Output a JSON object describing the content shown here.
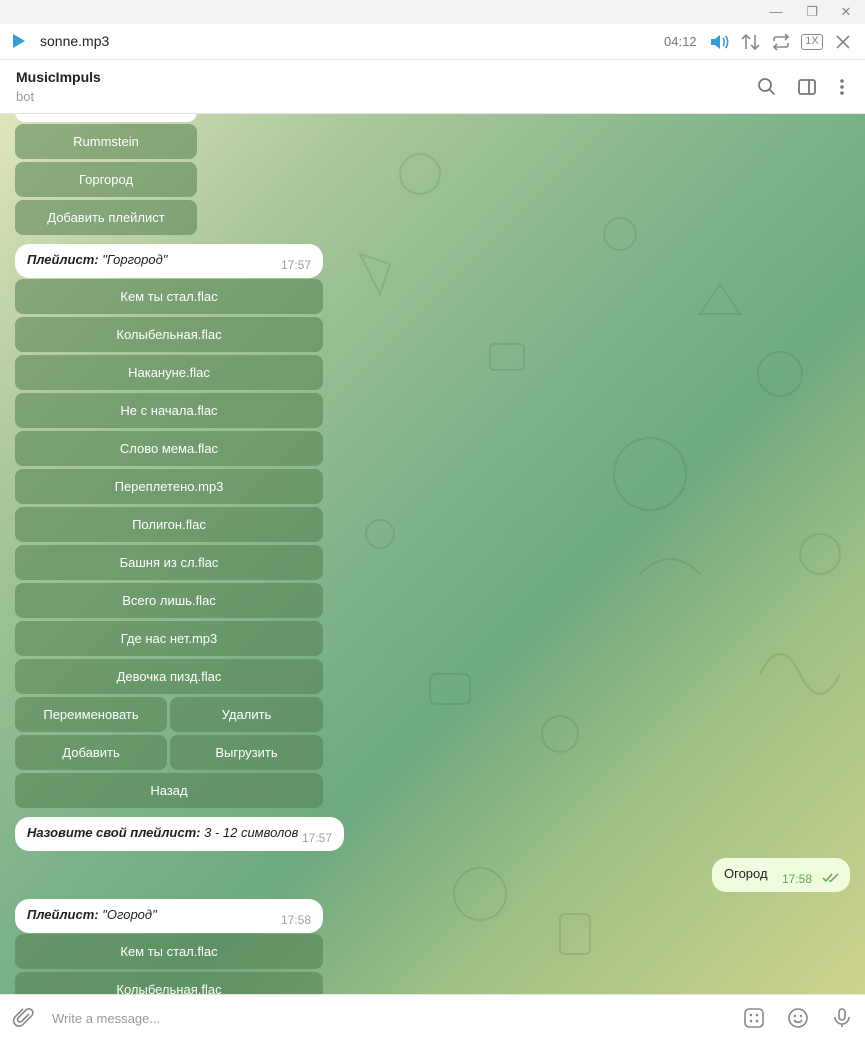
{
  "window": {
    "minimize": "—",
    "restore": "❐",
    "close": "✕"
  },
  "player": {
    "track": "sonne.mp3",
    "time": "04:12",
    "speed": "1X"
  },
  "header": {
    "name": "MusicImpuls",
    "status": "bot"
  },
  "top_keyboard": [
    "Rummstein",
    "Горгород",
    "Добавить плейлист"
  ],
  "msg1": {
    "label": "Плейлист:",
    "value": "\"Горгород\"",
    "time": "17:57"
  },
  "tracks1": [
    "Кем ты стал.flac",
    "Колыбельная.flac",
    "Накануне.flac",
    "Не с начала.flac",
    "Слово мема.flac",
    "Переплетено.mp3",
    "Полигон.flac",
    "Башня из сл.flac",
    "Всего лишь.flac",
    "Где нас нет.mp3",
    "Девочка пизд.flac"
  ],
  "actions": {
    "rename": "Переименовать",
    "delete": "Удалить",
    "add": "Добавить",
    "export": "Выгрузить",
    "back": "Назад"
  },
  "msg2": {
    "label": "Назовите свой плейлист:",
    "value": "3 - 12 символов",
    "time": "17:57"
  },
  "msg3": {
    "text": "Огород",
    "time": "17:58"
  },
  "msg4": {
    "label": "Плейлист:",
    "value": "\"Огород\"",
    "time": "17:58"
  },
  "tracks2": [
    "Кем ты стал.flac",
    "Колыбельная.flac"
  ],
  "composer": {
    "placeholder": "Write a message..."
  }
}
